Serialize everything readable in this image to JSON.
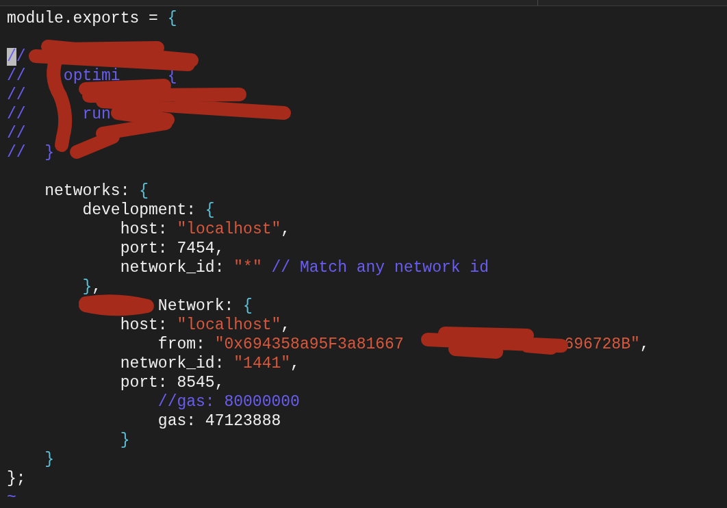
{
  "editor": {
    "lines": [
      {
        "tokens": [
          {
            "text": "module.exports = ",
            "kind": "plain"
          },
          {
            "text": "{",
            "kind": "brace"
          }
        ]
      },
      {
        "kind": "blank"
      },
      {
        "tokens": [
          {
            "text": "/",
            "kind": "cursor"
          },
          {
            "text": "/",
            "kind": "comment"
          }
        ]
      },
      {
        "tokens": [
          {
            "text": "//",
            "kind": "comment"
          },
          {
            "text": "    optimi",
            "kind": "comment"
          },
          {
            "text": "     {",
            "kind": "comment"
          }
        ]
      },
      {
        "tokens": [
          {
            "text": "//",
            "kind": "comment"
          }
        ]
      },
      {
        "tokens": [
          {
            "text": "//",
            "kind": "comment"
          },
          {
            "text": "      run",
            "kind": "comment"
          }
        ]
      },
      {
        "tokens": [
          {
            "text": "//",
            "kind": "comment"
          }
        ]
      },
      {
        "tokens": [
          {
            "text": "//",
            "kind": "comment"
          },
          {
            "text": "  }",
            "kind": "comment"
          }
        ]
      },
      {
        "kind": "blank"
      },
      {
        "tokens": [
          {
            "text": "    networks: ",
            "kind": "plain"
          },
          {
            "text": "{",
            "kind": "brace"
          }
        ]
      },
      {
        "tokens": [
          {
            "text": "        development: ",
            "kind": "plain"
          },
          {
            "text": "{",
            "kind": "brace"
          }
        ]
      },
      {
        "tokens": [
          {
            "text": "            host: ",
            "kind": "plain"
          },
          {
            "text": "\"localhost\"",
            "kind": "string"
          },
          {
            "text": ",",
            "kind": "plain"
          }
        ]
      },
      {
        "tokens": [
          {
            "text": "            port: 7454,",
            "kind": "plain"
          }
        ]
      },
      {
        "tokens": [
          {
            "text": "            network_id: ",
            "kind": "plain"
          },
          {
            "text": "\"*\"",
            "kind": "string"
          },
          {
            "text": " // Match any network id",
            "kind": "comment"
          }
        ]
      },
      {
        "tokens": [
          {
            "text": "        }",
            "kind": "brace"
          },
          {
            "text": ",",
            "kind": "plain"
          }
        ]
      },
      {
        "tokens": [
          {
            "text": "                Network: ",
            "kind": "plain"
          },
          {
            "text": "{",
            "kind": "brace"
          }
        ]
      },
      {
        "tokens": [
          {
            "text": "            host: ",
            "kind": "plain"
          },
          {
            "text": "\"localhost\"",
            "kind": "string"
          },
          {
            "text": ",",
            "kind": "plain"
          }
        ]
      },
      {
        "tokens": [
          {
            "text": "                from: ",
            "kind": "plain"
          },
          {
            "text": "\"0x694358a95F3a81667",
            "kind": "string"
          },
          {
            "text": "                 696728B\"",
            "kind": "string"
          },
          {
            "text": ",",
            "kind": "plain"
          }
        ]
      },
      {
        "tokens": [
          {
            "text": "            network_id: ",
            "kind": "plain"
          },
          {
            "text": "\"1441\"",
            "kind": "string"
          },
          {
            "text": ",",
            "kind": "plain"
          }
        ]
      },
      {
        "tokens": [
          {
            "text": "            port: 8545,",
            "kind": "plain"
          }
        ]
      },
      {
        "tokens": [
          {
            "text": "                //gas: 80000000",
            "kind": "comment"
          }
        ]
      },
      {
        "tokens": [
          {
            "text": "                gas: 47123888",
            "kind": "plain"
          }
        ]
      },
      {
        "tokens": [
          {
            "text": "            }",
            "kind": "brace"
          }
        ]
      },
      {
        "tokens": [
          {
            "text": "    }",
            "kind": "brace"
          }
        ]
      },
      {
        "tokens": [
          {
            "text": "};",
            "kind": "plain"
          }
        ]
      },
      {
        "tokens": [
          {
            "text": "~",
            "kind": "tilde"
          }
        ]
      }
    ]
  }
}
